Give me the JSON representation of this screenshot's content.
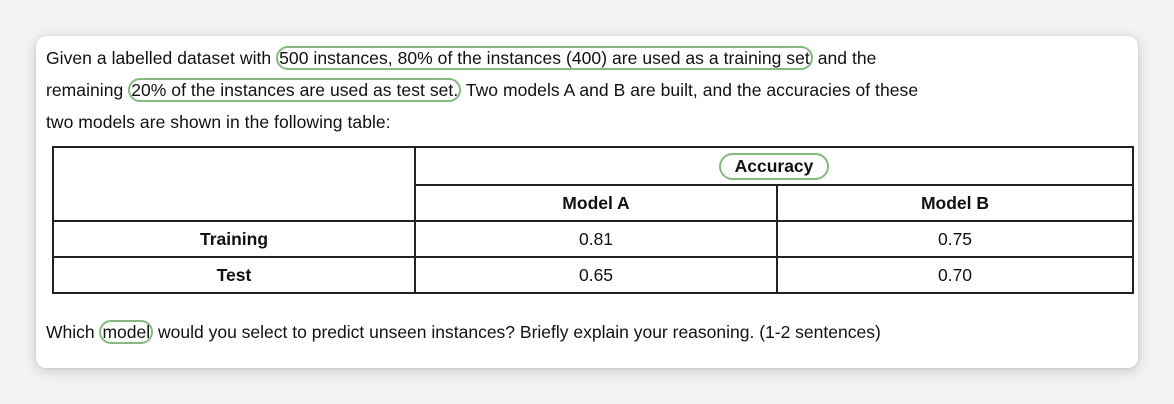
{
  "intro": {
    "l1_before": "Given a labelled dataset with ",
    "l1_highlight": "500 instances, 80% of the instances (400) are used as a training set",
    "l1_after": " and the",
    "l2_before": "remaining ",
    "l2_highlight": "20% of the instances are used as test set.",
    "l2_after": " Two models A and B are built, and the accuracies of these",
    "l3": "two models are shown in the following table:"
  },
  "table": {
    "group_header": "Accuracy",
    "columns": [
      "Model A",
      "Model B"
    ],
    "rows": [
      {
        "label": "Training",
        "values": [
          "0.81",
          "0.75"
        ]
      },
      {
        "label": "Test",
        "values": [
          "0.65",
          "0.70"
        ]
      }
    ]
  },
  "question": {
    "before": "Which ",
    "highlight": "model",
    "after": " would you select to predict unseen instances? Briefly explain your reasoning. (1-2 sentences)"
  },
  "colors": {
    "highlight": "#82bb7d",
    "border": "#222222",
    "background": "#ffffff"
  }
}
